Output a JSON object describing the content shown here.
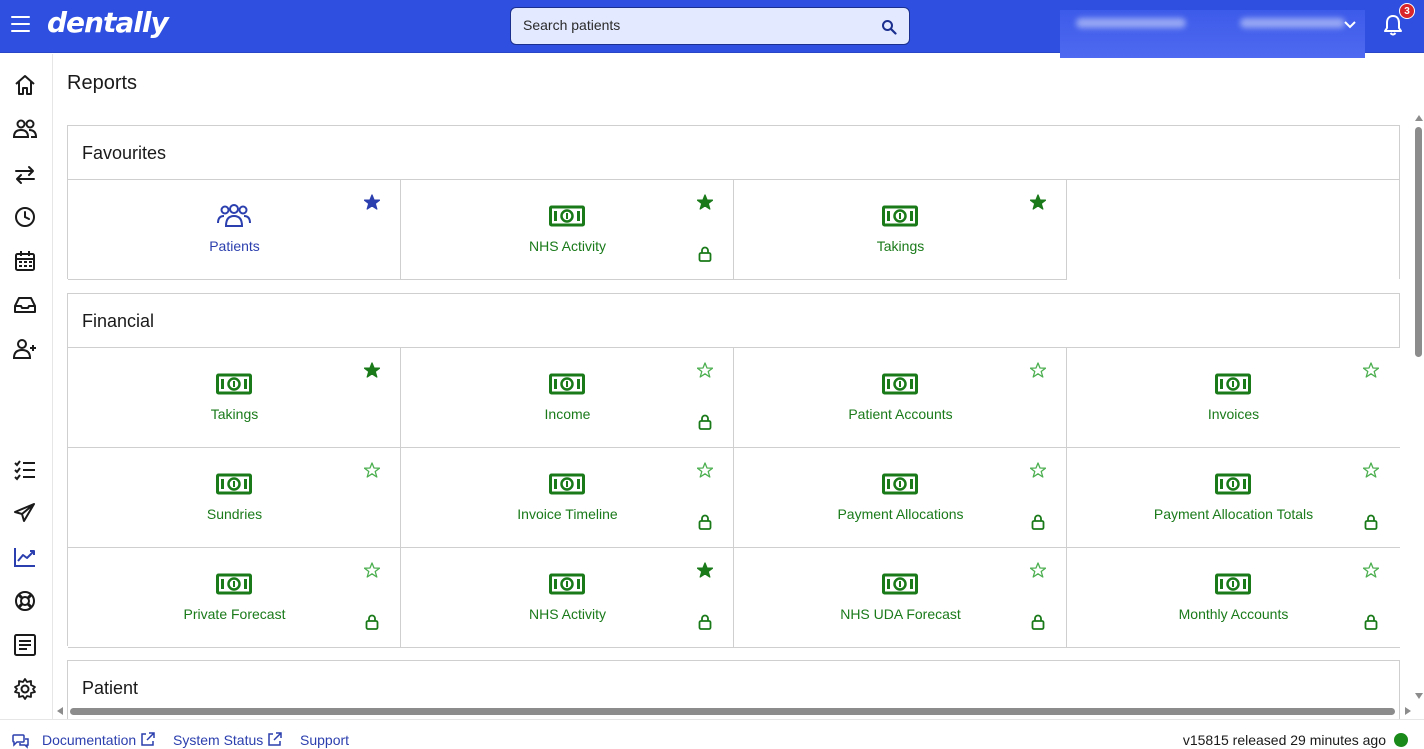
{
  "app": {
    "brand": "dentally"
  },
  "colors": {
    "primary": "#2f4fe0",
    "money_green": "#1a7a1a",
    "star_blue": "#2c3fae",
    "badge_red": "#d9262a",
    "status_green": "#1a8a1a"
  },
  "header": {
    "search_placeholder": "Search patients",
    "notifications_count": "3"
  },
  "sidebar": {
    "items": [
      {
        "name": "home-icon"
      },
      {
        "name": "patients-icon"
      },
      {
        "name": "transfer-icon"
      },
      {
        "name": "clock-icon"
      },
      {
        "name": "calendar-icon"
      },
      {
        "name": "inbox-icon"
      },
      {
        "name": "add-user-icon"
      },
      {
        "name": "checklist-icon"
      },
      {
        "name": "send-icon"
      },
      {
        "name": "reports-chart-icon"
      },
      {
        "name": "support-lifebuoy-icon"
      },
      {
        "name": "document-icon"
      },
      {
        "name": "settings-gear-icon"
      }
    ]
  },
  "page": {
    "title": "Reports"
  },
  "sections": {
    "favourites": {
      "title": "Favourites",
      "tiles": [
        {
          "label": "Patients",
          "icon": "patients-group-icon",
          "starred": true,
          "locked": false
        },
        {
          "label": "NHS Activity",
          "icon": "money-icon",
          "starred": true,
          "locked": true
        },
        {
          "label": "Takings",
          "icon": "money-icon",
          "starred": true,
          "locked": false
        }
      ]
    },
    "financial": {
      "title": "Financial",
      "tiles": [
        {
          "label": "Takings",
          "icon": "money-icon",
          "starred": true,
          "locked": false
        },
        {
          "label": "Income",
          "icon": "money-icon",
          "starred": false,
          "locked": true
        },
        {
          "label": "Patient Accounts",
          "icon": "money-icon",
          "starred": false,
          "locked": false
        },
        {
          "label": "Invoices",
          "icon": "money-icon",
          "starred": false,
          "locked": false
        },
        {
          "label": "Sundries",
          "icon": "money-icon",
          "starred": false,
          "locked": false
        },
        {
          "label": "Invoice Timeline",
          "icon": "money-icon",
          "starred": false,
          "locked": true
        },
        {
          "label": "Payment Allocations",
          "icon": "money-icon",
          "starred": false,
          "locked": true
        },
        {
          "label": "Payment Allocation Totals",
          "icon": "money-icon",
          "starred": false,
          "locked": true
        },
        {
          "label": "Private Forecast",
          "icon": "money-icon",
          "starred": false,
          "locked": true
        },
        {
          "label": "NHS Activity",
          "icon": "money-icon",
          "starred": true,
          "locked": true
        },
        {
          "label": "NHS UDA Forecast",
          "icon": "money-icon",
          "starred": false,
          "locked": true
        },
        {
          "label": "Monthly Accounts",
          "icon": "money-icon",
          "starred": false,
          "locked": true
        }
      ]
    },
    "patient": {
      "title": "Patient"
    }
  },
  "footer": {
    "documentation": "Documentation",
    "system_status": "System Status",
    "support": "Support",
    "version": "v15815 released 29 minutes ago"
  }
}
